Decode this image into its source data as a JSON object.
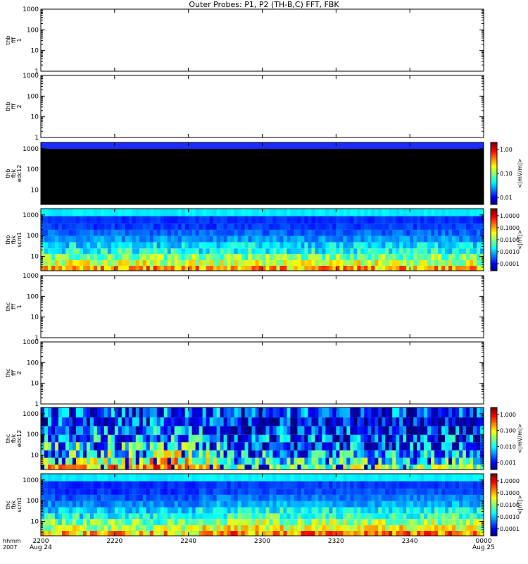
{
  "title": "Outer Probes: P1, P2 (TH-B,C) FFT, FBK",
  "colors": {
    "black_band": "#000000",
    "top_band": "#1a2cff",
    "cyan": "#18e0f0"
  },
  "chart_data": {
    "type": "heatmap",
    "x_tick_labels": [
      "2200",
      "2220",
      "2240",
      "2300",
      "2320",
      "2340",
      "0000"
    ],
    "x_date_labels": {
      "start": "Aug 24",
      "end": "Aug 25"
    },
    "x_row_labels": [
      "hhmm",
      "2007"
    ],
    "y_scale": "log",
    "panels": [
      {
        "name": "thb-fff-1",
        "ylabel": [
          "thb",
          "fff",
          "1"
        ],
        "y_ticks": [
          "1",
          "10",
          "100",
          "1000"
        ],
        "ylim": [
          1,
          1000
        ],
        "kind": "empty"
      },
      {
        "name": "thb-fff-2",
        "ylabel": [
          "thb",
          "fff",
          "2"
        ],
        "y_ticks": [
          "1",
          "10",
          "100",
          "1000"
        ],
        "ylim": [
          1,
          1000
        ],
        "kind": "empty"
      },
      {
        "name": "thb-fbk-edc12",
        "ylabel": [
          "thb",
          "fbk",
          "edc12"
        ],
        "y_ticks": [
          "10",
          "100",
          "1000"
        ],
        "ylim": [
          2,
          2000
        ],
        "kind": "black",
        "colorbar": {
          "ticks": [
            "1.00",
            "0.10",
            "0.01"
          ],
          "label": "<|mV/m|>"
        }
      },
      {
        "name": "thb-fbk-scm1",
        "ylabel": [
          "thb",
          "fbk",
          "scm1"
        ],
        "y_ticks": [
          "10",
          "100",
          "1000"
        ],
        "ylim": [
          2,
          2000
        ],
        "kind": "spec_scm",
        "colorbar": {
          "ticks": [
            "1.0000",
            "0.1000",
            "0.0100",
            "0.0010",
            "0.0001"
          ],
          "label": "<|nT|>"
        }
      },
      {
        "name": "thc-fff-1",
        "ylabel": [
          "thc",
          "fff",
          "1"
        ],
        "y_ticks": [
          "1",
          "10",
          "100",
          "1000"
        ],
        "ylim": [
          1,
          1000
        ],
        "kind": "empty"
      },
      {
        "name": "thc-fff-2",
        "ylabel": [
          "thc",
          "fff",
          "2"
        ],
        "y_ticks": [
          "1",
          "10",
          "100",
          "1000"
        ],
        "ylim": [
          1,
          1000
        ],
        "kind": "empty"
      },
      {
        "name": "thc-fbk-edc12",
        "ylabel": [
          "thc",
          "fbk",
          "edc12"
        ],
        "y_ticks": [
          "10",
          "100",
          "1000"
        ],
        "ylim": [
          2,
          2000
        ],
        "kind": "spec_edc",
        "colorbar": {
          "ticks": [
            "1.000",
            "0.100",
            "0.010",
            "0.001"
          ],
          "label": "<|mV/m|>"
        }
      },
      {
        "name": "thc-fbk-scm1",
        "ylabel": [
          "thc",
          "fbk",
          "scm1"
        ],
        "y_ticks": [
          "10",
          "100",
          "1000"
        ],
        "ylim": [
          2,
          2000
        ],
        "kind": "spec_scm2",
        "colorbar": {
          "ticks": [
            "1.0000",
            "0.1000",
            "0.0100",
            "0.0010",
            "0.0001"
          ],
          "label": "<|nT|>"
        }
      }
    ]
  }
}
